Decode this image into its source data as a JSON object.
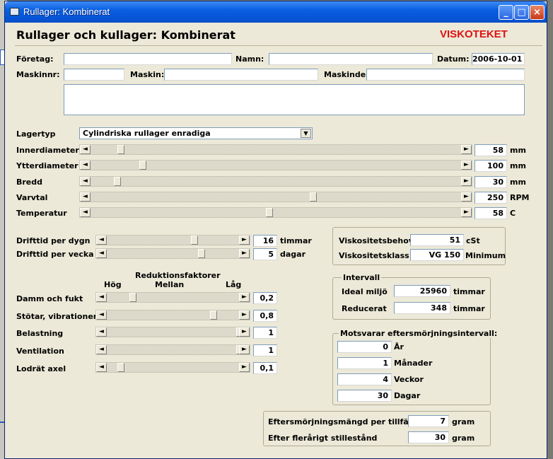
{
  "window": {
    "title": "Rullager: Kombinerat"
  },
  "header": {
    "title": "Rullager och kullager: Kombinerat",
    "brand": "VISKOTEKET"
  },
  "info": {
    "company_label": "Företag:",
    "company_value": "",
    "name_label": "Namn:",
    "name_value": "",
    "date_label": "Datum:",
    "date_value": "2006-10-01",
    "machine_no_label": "Maskinnr:",
    "machine_no_value": "",
    "machine_label": "Maskin:",
    "machine_value": "",
    "machine_part_label": "Maskindel:",
    "machine_part_value": "",
    "notes_value": ""
  },
  "bearing": {
    "type_label": "Lagertyp",
    "type_value": "Cylindriska rullager enradiga",
    "params": [
      {
        "label": "Innerdiameter",
        "value": "58",
        "unit": "mm",
        "level": 0.08
      },
      {
        "label": "Ytterdiameter",
        "value": "100",
        "unit": "mm",
        "level": 0.14
      },
      {
        "label": "Bredd",
        "value": "30",
        "unit": "mm",
        "level": 0.07
      },
      {
        "label": "Varvtal",
        "value": "250",
        "unit": "RPM",
        "level": 0.6
      },
      {
        "label": "Temperatur",
        "value": "58",
        "unit": "C",
        "level": 0.48
      }
    ]
  },
  "operation": {
    "items": [
      {
        "label": "Drifttid per dygn",
        "value": "16",
        "unit": "timmar",
        "level": 0.66
      },
      {
        "label": "Drifttid per vecka",
        "value": "5",
        "unit": "dagar",
        "level": 0.71
      }
    ]
  },
  "reduction": {
    "title": "Reduktionsfaktorer",
    "scale_high": "Hög",
    "scale_mid": "Mellan",
    "scale_low": "Låg",
    "items": [
      {
        "label": "Damm och fukt",
        "value": "0,2",
        "level": 0.19
      },
      {
        "label": "Stötar, vibrationer",
        "value": "0,8",
        "level": 0.8
      },
      {
        "label": "Belastning",
        "value": "1",
        "level": 1.0
      },
      {
        "label": "Ventilation",
        "value": "1",
        "level": 1.0
      },
      {
        "label": "Lodrät axel",
        "value": "0,1",
        "level": 0.1
      }
    ]
  },
  "viscosity": {
    "need_label": "Viskositetsbehov",
    "need_value": "51",
    "need_unit": "cSt",
    "class_label": "Viskositetsklass",
    "class_value": "VG 150",
    "class_note": "Minimum"
  },
  "interval": {
    "title": "Intervall",
    "ideal_label": "Ideal miljö",
    "ideal_value": "25960",
    "ideal_unit": "timmar",
    "reduced_label": "Reducerat",
    "reduced_value": "348",
    "reduced_unit": "timmar"
  },
  "equivalent": {
    "title": "Motsvarar eftersmörjningsintervall:",
    "rows": [
      {
        "value": "0",
        "unit": "År"
      },
      {
        "value": "1",
        "unit": "Månader"
      },
      {
        "value": "4",
        "unit": "Veckor"
      },
      {
        "value": "30",
        "unit": "Dagar"
      }
    ]
  },
  "regrease": {
    "amount_label": "Eftersmörjningsmängd per tillfälle",
    "amount_value": "7",
    "amount_unit": "gram",
    "standstill_label": "Efter flerårigt stillestånd",
    "standstill_value": "30",
    "standstill_unit": "gram"
  }
}
